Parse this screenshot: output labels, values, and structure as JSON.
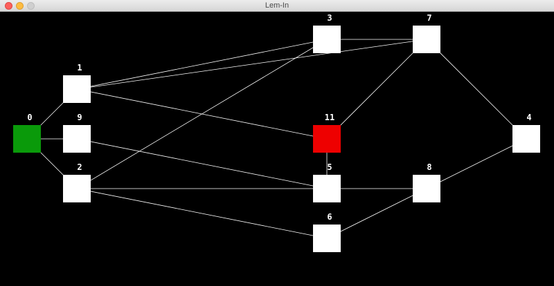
{
  "window": {
    "title": "Lem-In"
  },
  "colors": {
    "background": "#000000",
    "room": "#ffffff",
    "start_room": "#0a9a0a",
    "end_room": "#ee0000",
    "link": "#ffffff"
  },
  "graph": {
    "rooms": [
      {
        "id": "0",
        "label": "0",
        "role": "start"
      },
      {
        "id": "1",
        "label": "1",
        "role": "room"
      },
      {
        "id": "9",
        "label": "9",
        "role": "room"
      },
      {
        "id": "2",
        "label": "2",
        "role": "room"
      },
      {
        "id": "3",
        "label": "3",
        "role": "room"
      },
      {
        "id": "7",
        "label": "7",
        "role": "room"
      },
      {
        "id": "11",
        "label": "11",
        "role": "end"
      },
      {
        "id": "5",
        "label": "5",
        "role": "room"
      },
      {
        "id": "6",
        "label": "6",
        "role": "room"
      },
      {
        "id": "8",
        "label": "8",
        "role": "room"
      },
      {
        "id": "4",
        "label": "4",
        "role": "room"
      }
    ],
    "links": [
      [
        "0",
        "1"
      ],
      [
        "0",
        "9"
      ],
      [
        "0",
        "2"
      ],
      [
        "1",
        "3"
      ],
      [
        "1",
        "7"
      ],
      [
        "1",
        "11"
      ],
      [
        "9",
        "5"
      ],
      [
        "2",
        "3"
      ],
      [
        "2",
        "5"
      ],
      [
        "2",
        "6"
      ],
      [
        "3",
        "7"
      ],
      [
        "7",
        "11"
      ],
      [
        "7",
        "4"
      ],
      [
        "11",
        "5"
      ],
      [
        "5",
        "8"
      ],
      [
        "6",
        "8"
      ],
      [
        "8",
        "4"
      ]
    ]
  }
}
